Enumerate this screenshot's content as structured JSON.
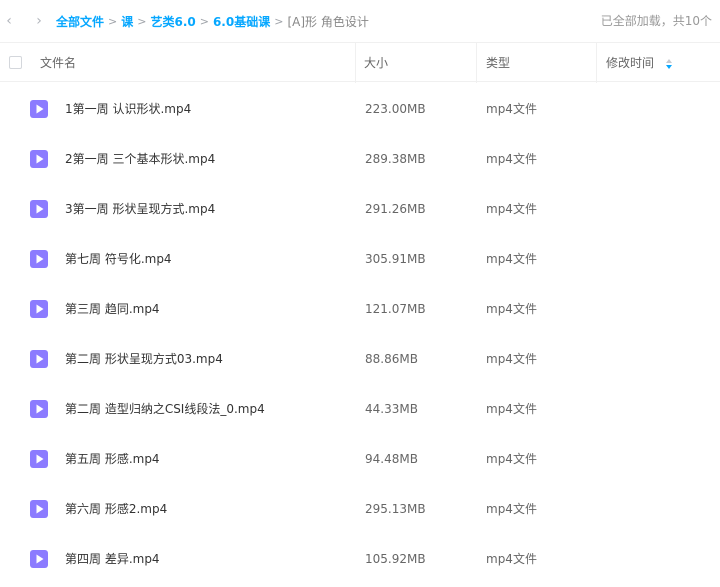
{
  "nav": {
    "back_icon": "chevron-left-icon",
    "forward_icon": "chevron-right-icon"
  },
  "breadcrumb": [
    {
      "label": "全部文件"
    },
    {
      "label": "课"
    },
    {
      "label": "艺类6.0"
    },
    {
      "label": "6.0基础课"
    },
    {
      "label": "[A]形 角色设计"
    }
  ],
  "status_text": "已全部加载，共10个",
  "columns": {
    "name": "文件名",
    "size": "大小",
    "type": "类型",
    "mtime": "修改时间"
  },
  "colors": {
    "accent": "#06a7ff",
    "video_icon": "#8c7bff"
  },
  "files": [
    {
      "name": "1第一周 认识形状.mp4",
      "size": "223.00MB",
      "type": "mp4文件",
      "icon": "video-file-icon"
    },
    {
      "name": "2第一周 三个基本形状.mp4",
      "size": "289.38MB",
      "type": "mp4文件",
      "icon": "video-file-icon"
    },
    {
      "name": "3第一周 形状呈现方式.mp4",
      "size": "291.26MB",
      "type": "mp4文件",
      "icon": "video-file-icon"
    },
    {
      "name": "第七周 符号化.mp4",
      "size": "305.91MB",
      "type": "mp4文件",
      "icon": "video-file-icon"
    },
    {
      "name": "第三周 趋同.mp4",
      "size": "121.07MB",
      "type": "mp4文件",
      "icon": "video-file-icon"
    },
    {
      "name": "第二周 形状呈现方式03.mp4",
      "size": "88.86MB",
      "type": "mp4文件",
      "icon": "video-file-icon"
    },
    {
      "name": "第二周 造型归纳之CSI线段法_0.mp4",
      "size": "44.33MB",
      "type": "mp4文件",
      "icon": "video-file-icon"
    },
    {
      "name": "第五周 形感.mp4",
      "size": "94.48MB",
      "type": "mp4文件",
      "icon": "video-file-icon"
    },
    {
      "name": "第六周 形感2.mp4",
      "size": "295.13MB",
      "type": "mp4文件",
      "icon": "video-file-icon"
    },
    {
      "name": "第四周 差异.mp4",
      "size": "105.92MB",
      "type": "mp4文件",
      "icon": "video-file-icon"
    }
  ]
}
